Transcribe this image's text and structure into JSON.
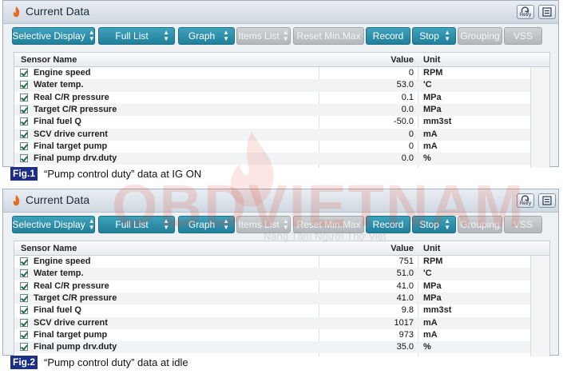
{
  "panels": [
    {
      "title": "Current Data",
      "retry_label": "Retry",
      "toolbar": {
        "selective_display": "Selective Display",
        "full_list": "Full List",
        "graph": "Graph",
        "items_list": "Items List",
        "reset_min_max": "Reset Min.Max",
        "record": "Record",
        "stop": "Stop",
        "grouping": "Grouping",
        "vss": "VSS"
      },
      "columns": {
        "name": "Sensor Name",
        "value": "Value",
        "unit": "Unit"
      },
      "rows": [
        {
          "name": "Engine speed",
          "value": "0",
          "unit": "RPM",
          "checked": true
        },
        {
          "name": "Water temp.",
          "value": "53.0",
          "unit": "'C",
          "checked": true
        },
        {
          "name": "Real C/R pressure",
          "value": "0.1",
          "unit": "MPa",
          "checked": true
        },
        {
          "name": "Target C/R pressure",
          "value": "0.0",
          "unit": "MPa",
          "checked": true
        },
        {
          "name": "Final fuel Q",
          "value": "-50.0",
          "unit": "mm3st",
          "checked": true
        },
        {
          "name": "SCV drive current",
          "value": "0",
          "unit": "mA",
          "checked": true
        },
        {
          "name": "Final target pump",
          "value": "0",
          "unit": "mA",
          "checked": true
        },
        {
          "name": "Final pump drv.duty",
          "value": "0.0",
          "unit": "%",
          "checked": true
        }
      ],
      "caption": {
        "badge": "Fig.1",
        "text": "“Pump control duty” data at IG ON"
      }
    },
    {
      "title": "Current Data",
      "retry_label": "Retry",
      "toolbar": {
        "selective_display": "Selective Display",
        "full_list": "Full List",
        "graph": "Graph",
        "items_list": "Items List",
        "reset_min_max": "Reset Min.Max",
        "record": "Record",
        "stop": "Stop",
        "grouping": "Grouping",
        "vss": "VSS"
      },
      "columns": {
        "name": "Sensor Name",
        "value": "Value",
        "unit": "Unit"
      },
      "rows": [
        {
          "name": "Engine speed",
          "value": "751",
          "unit": "RPM",
          "checked": true
        },
        {
          "name": "Water temp.",
          "value": "51.0",
          "unit": "'C",
          "checked": true
        },
        {
          "name": "Real C/R pressure",
          "value": "41.0",
          "unit": "MPa",
          "checked": true
        },
        {
          "name": "Target C/R pressure",
          "value": "41.0",
          "unit": "MPa",
          "checked": true
        },
        {
          "name": "Final fuel Q",
          "value": "9.8",
          "unit": "mm3st",
          "checked": true
        },
        {
          "name": "SCV drive current",
          "value": "1017",
          "unit": "mA",
          "checked": true
        },
        {
          "name": "Final target pump",
          "value": "973",
          "unit": "mA",
          "checked": true
        },
        {
          "name": "Final pump drv.duty",
          "value": "35.0",
          "unit": "%",
          "checked": true
        }
      ],
      "caption": {
        "badge": "Fig.2",
        "text": "“Pump control duty” data at idle"
      }
    }
  ],
  "watermark": {
    "text": "OBDVIETNAM",
    "subtext": "Nâng Tầm Người Thợ Việt"
  },
  "colors": {
    "accent_button": "#2a8aa6",
    "disabled_button": "#bfc4c8",
    "fig_badge": "#1c2e86"
  }
}
